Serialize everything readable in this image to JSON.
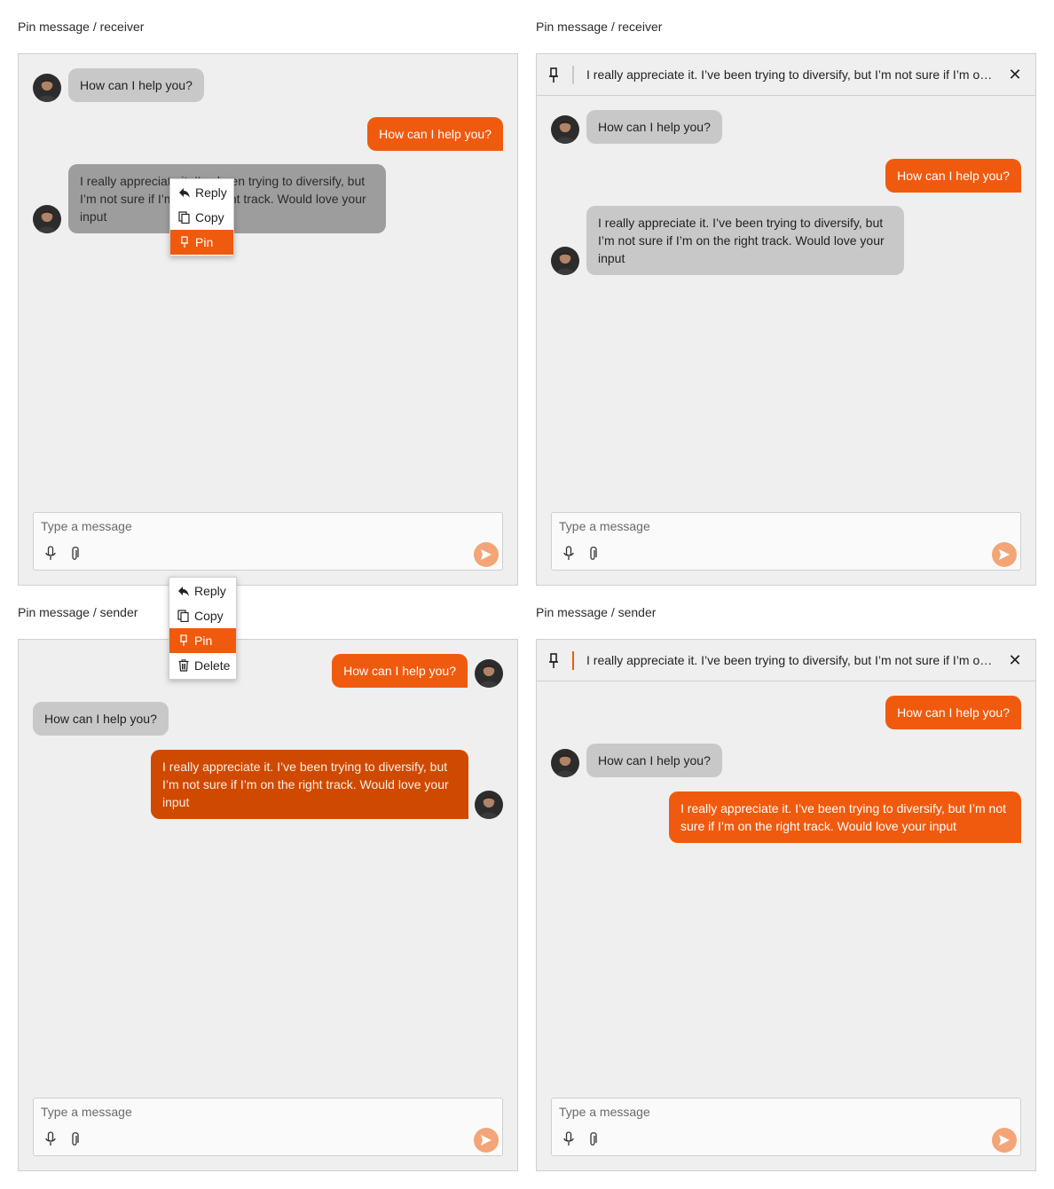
{
  "panels": [
    {
      "caption": "Pin message / receiver",
      "messages": [
        {
          "text": "How can I help you?"
        },
        {
          "text": "How can I help you?"
        },
        {
          "text": "I really appreciate it. I’ve been trying to diversify, but I’m not sure if I’m on the right track. Would love your input"
        }
      ],
      "menu": {
        "items": [
          "Reply",
          "Copy",
          "Pin"
        ],
        "active": "Pin"
      },
      "composer": {
        "placeholder": "Type a message"
      }
    },
    {
      "caption": "Pin message / receiver",
      "pinned": {
        "text": "I really appreciate it. I’ve been trying to diversify, but I’m not sure if I’m on the right track. Would love your input"
      },
      "messages": [
        {
          "text": "How can I help you?"
        },
        {
          "text": "How can I help you?"
        },
        {
          "text": "I really appreciate it. I’ve been trying to diversify, but I’m not sure if I’m on the right track. Would love your input"
        }
      ],
      "composer": {
        "placeholder": "Type a message"
      }
    },
    {
      "caption": "Pin message / sender",
      "messages": [
        {
          "text": "How can I help you?"
        },
        {
          "text": "How can I help you?"
        },
        {
          "text": "I really appreciate it. I’ve been trying to diversify, but I’m not sure if I’m on the right track. Would love your input"
        }
      ],
      "menu": {
        "items": [
          "Reply",
          "Copy",
          "Pin",
          "Delete"
        ],
        "active": "Pin"
      },
      "composer": {
        "placeholder": "Type a message"
      }
    },
    {
      "caption": "Pin message / sender",
      "pinned": {
        "text": "I really appreciate it. I’ve been trying to diversify, but I’m not sure if I’m on the right track. Would love your input"
      },
      "messages": [
        {
          "text": "How can I help you?"
        },
        {
          "text": "How can I help you?"
        },
        {
          "text": "I really appreciate it. I’ve been trying to diversify, but I’m not sure if I’m on the right track. Would love your input"
        }
      ],
      "composer": {
        "placeholder": "Type a message"
      }
    }
  ],
  "colors": {
    "accent": "#f05a0e",
    "accent_dark": "#cf4a00",
    "incoming_bubble": "#c8c8c8",
    "panel_bg": "#efefef",
    "send_button": "#f3a577"
  },
  "icons": {
    "pin": "pin-icon",
    "close": "close-icon",
    "reply": "reply-icon",
    "copy": "copy-icon",
    "delete": "trash-icon",
    "mic": "microphone-icon",
    "attach": "paperclip-icon",
    "send": "send-icon"
  }
}
